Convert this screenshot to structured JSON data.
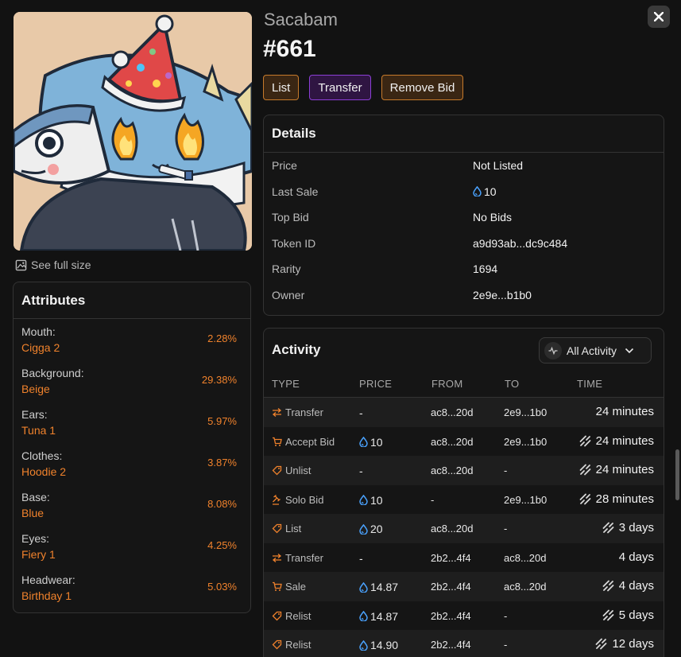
{
  "close": {
    "icon": "close-icon"
  },
  "left": {
    "full_size_label": "See full size",
    "attributes_title": "Attributes",
    "attributes": [
      {
        "name": "Mouth:",
        "value": "Cigga 2",
        "pct": "2.28%"
      },
      {
        "name": "Background:",
        "value": "Beige",
        "pct": "29.38%"
      },
      {
        "name": "Ears:",
        "value": "Tuna 1",
        "pct": "5.97%"
      },
      {
        "name": "Clothes:",
        "value": "Hoodie 2",
        "pct": "3.87%"
      },
      {
        "name": "Base:",
        "value": "Blue",
        "pct": "8.08%"
      },
      {
        "name": "Eyes:",
        "value": "Fiery 1",
        "pct": "4.25%"
      },
      {
        "name": "Headwear:",
        "value": "Birthday 1",
        "pct": "5.03%"
      }
    ]
  },
  "header": {
    "collection": "Sacabam",
    "token": "#661",
    "actions": {
      "list": "List",
      "transfer": "Transfer",
      "remove_bid": "Remove Bid"
    }
  },
  "details": {
    "title": "Details",
    "rows": [
      {
        "label": "Price",
        "value": "Not Listed"
      },
      {
        "label": "Last Sale",
        "value": "10"
      },
      {
        "label": "Top Bid",
        "value": "No Bids"
      },
      {
        "label": "Token ID",
        "value": "a9d93ab...dc9c484"
      },
      {
        "label": "Rarity",
        "value": "1694"
      },
      {
        "label": "Owner",
        "value": "2e9e...b1b0"
      }
    ]
  },
  "activity": {
    "title": "Activity",
    "filter_label": "All Activity",
    "columns": {
      "type": "TYPE",
      "price": "PRICE",
      "from": "FROM",
      "to": "TO",
      "time": "TIME"
    },
    "rows": [
      {
        "type": "Transfer",
        "icon": "transfer-icon",
        "price": "-",
        "from": "ac8...20d",
        "to": "2e9...1b0",
        "time": "24 minutes",
        "linked": false
      },
      {
        "type": "Accept Bid",
        "icon": "cart-icon",
        "price": "10",
        "from": "ac8...20d",
        "to": "2e9...1b0",
        "time": "24 minutes",
        "linked": true
      },
      {
        "type": "Unlist",
        "icon": "tag-icon",
        "price": "-",
        "from": "ac8...20d",
        "to": "-",
        "time": "24 minutes",
        "linked": true
      },
      {
        "type": "Solo Bid",
        "icon": "gavel-icon",
        "price": "10",
        "from": "-",
        "to": "2e9...1b0",
        "time": "28 minutes",
        "linked": true
      },
      {
        "type": "List",
        "icon": "tag-icon",
        "price": "20",
        "from": "ac8...20d",
        "to": "-",
        "time": "3 days",
        "linked": true
      },
      {
        "type": "Transfer",
        "icon": "transfer-icon",
        "price": "-",
        "from": "2b2...4f4",
        "to": "ac8...20d",
        "time": "4 days",
        "linked": false
      },
      {
        "type": "Sale",
        "icon": "cart-icon",
        "price": "14.87",
        "from": "2b2...4f4",
        "to": "ac8...20d",
        "time": "4 days",
        "linked": true
      },
      {
        "type": "Relist",
        "icon": "tag-icon",
        "price": "14.87",
        "from": "2b2...4f4",
        "to": "-",
        "time": "5 days",
        "linked": true
      },
      {
        "type": "Relist",
        "icon": "tag-icon",
        "price": "14.90",
        "from": "2b2...4f4",
        "to": "-",
        "time": "12 days",
        "linked": true
      }
    ]
  },
  "colors": {
    "accent": "#f0822c",
    "purple": "#8c3fd6",
    "token_blue": "#4aa3ff"
  }
}
